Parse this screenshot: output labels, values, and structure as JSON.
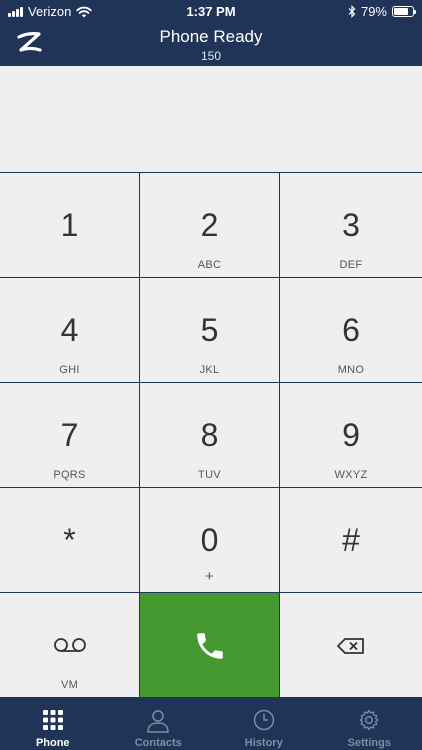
{
  "status_bar": {
    "carrier": "Verizon",
    "time": "1:37 PM",
    "battery_percent": "79%",
    "battery_level": 0.79,
    "icons": [
      "signal-icon",
      "wifi-icon",
      "bluetooth-icon",
      "battery-icon"
    ]
  },
  "header": {
    "title": "Phone Ready",
    "subtitle": "150",
    "logo_icon": "z-logo-icon"
  },
  "display": {
    "number": ""
  },
  "keypad": {
    "keys": [
      {
        "digit": "1",
        "letters": ""
      },
      {
        "digit": "2",
        "letters": "ABC"
      },
      {
        "digit": "3",
        "letters": "DEF"
      },
      {
        "digit": "4",
        "letters": "GHI"
      },
      {
        "digit": "5",
        "letters": "JKL"
      },
      {
        "digit": "6",
        "letters": "MNO"
      },
      {
        "digit": "7",
        "letters": "PQRS"
      },
      {
        "digit": "8",
        "letters": "TUV"
      },
      {
        "digit": "9",
        "letters": "WXYZ"
      },
      {
        "digit": "*",
        "letters": ""
      },
      {
        "digit": "0",
        "letters": "+"
      },
      {
        "digit": "#",
        "letters": ""
      }
    ],
    "voicemail_label": "VM",
    "call_icon": "phone-icon",
    "backspace_icon": "backspace-icon"
  },
  "tabbar": {
    "tabs": [
      {
        "label": "Phone",
        "icon": "keypad-icon",
        "active": true
      },
      {
        "label": "Contacts",
        "icon": "contacts-icon",
        "active": false
      },
      {
        "label": "History",
        "icon": "clock-icon",
        "active": false
      },
      {
        "label": "Settings",
        "icon": "gear-icon",
        "active": false
      }
    ]
  },
  "colors": {
    "navy": "#1f3457",
    "key_bg": "#efefef",
    "call_green": "#44982f",
    "tab_inactive": "#7f8ca3"
  }
}
